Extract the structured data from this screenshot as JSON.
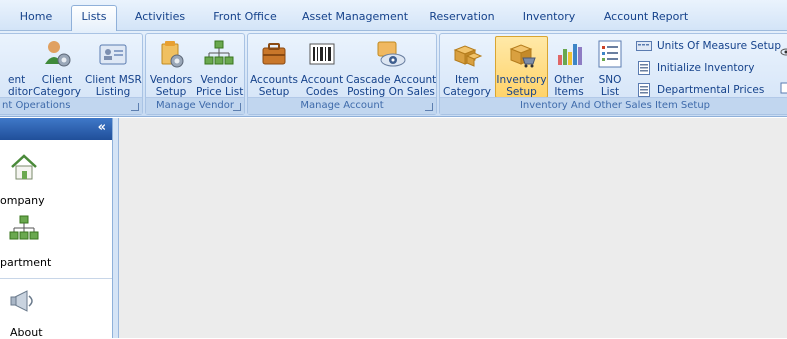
{
  "tabs": [
    {
      "label": "Home"
    },
    {
      "label": "Lists",
      "active": true
    },
    {
      "label": "Activities"
    },
    {
      "label": "Front Office"
    },
    {
      "label": "Asset Management"
    },
    {
      "label": "Reservation"
    },
    {
      "label": "Inventory"
    },
    {
      "label": "Account Report"
    }
  ],
  "ribbon": {
    "groups": [
      {
        "caption": "nt Operations",
        "buttons": [
          {
            "line1": "ent",
            "line2": "ditor",
            "icon": "client-editor-icon"
          },
          {
            "line1": "Client",
            "line2": "Category",
            "icon": "client-category-icon"
          },
          {
            "line1": "Client MSR",
            "line2": "Listing",
            "icon": "client-msr-listing-icon"
          }
        ]
      },
      {
        "caption": "Manage Vendor",
        "buttons": [
          {
            "line1": "Vendors",
            "line2": "Setup",
            "icon": "vendors-setup-icon"
          },
          {
            "line1": "Vendor",
            "line2": "Price List",
            "icon": "vendor-price-list-icon"
          }
        ]
      },
      {
        "caption": "Manage Account",
        "buttons": [
          {
            "line1": "Accounts",
            "line2": "Setup",
            "icon": "accounts-setup-icon"
          },
          {
            "line1": "Account",
            "line2": "Codes",
            "icon": "account-codes-icon"
          },
          {
            "line1": "Cascade Account",
            "line2": "Posting On Sales",
            "icon": "cascade-account-icon"
          }
        ]
      },
      {
        "caption": "Inventory And Other Sales Item Setup",
        "buttons": [
          {
            "line1": "Item",
            "line2": "Category",
            "icon": "item-category-icon"
          },
          {
            "line1": "Inventory",
            "line2": "Setup",
            "icon": "inventory-setup-icon",
            "active": true
          },
          {
            "line1": "Other",
            "line2": "Items",
            "icon": "other-items-icon"
          },
          {
            "line1": "SNO",
            "line2": "List",
            "icon": "sno-list-icon"
          }
        ],
        "small_buttons": [
          {
            "label": "Units Of Measure Setup",
            "icon": "units-of-measure-icon"
          },
          {
            "label": "Initialize Inventory",
            "icon": "initialize-inventory-icon"
          },
          {
            "label": "Departmental Prices",
            "icon": "departmental-prices-icon"
          }
        ]
      }
    ]
  },
  "nav": {
    "collapse_glyph": "«",
    "items": [
      {
        "label": "ompany",
        "icon": "home-icon"
      },
      {
        "label": "partment",
        "icon": "department-icon"
      },
      {
        "label": "About",
        "icon": "megaphone-icon"
      }
    ]
  },
  "colors": {
    "accent": "#15428b",
    "active_tab": "#ffffff",
    "active_button": "#ffd36a",
    "nav_header": "#2a5eaa",
    "content_bg": "#ececec"
  }
}
